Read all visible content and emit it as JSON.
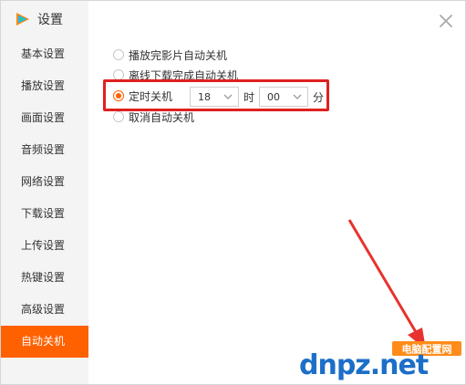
{
  "window": {
    "title": "设置"
  },
  "sidebar": {
    "items": [
      {
        "label": "基本设置"
      },
      {
        "label": "播放设置"
      },
      {
        "label": "画面设置"
      },
      {
        "label": "音频设置"
      },
      {
        "label": "网络设置"
      },
      {
        "label": "下载设置"
      },
      {
        "label": "上传设置"
      },
      {
        "label": "热键设置"
      },
      {
        "label": "高级设置"
      },
      {
        "label": "自动关机",
        "active": true
      }
    ]
  },
  "options": {
    "after_playback": "播放完影片自动关机",
    "after_download": "离线下载完成自动关机",
    "timed": "定时关机",
    "cancel": "取消自动关机",
    "selected": "timed"
  },
  "timer": {
    "hour_value": "18",
    "hour_unit": "时",
    "minute_value": "00",
    "minute_unit": "分"
  },
  "watermark": {
    "logo_text": "dnpz.net",
    "badge_text": "电脑配置网"
  },
  "colors": {
    "accent": "#ff6000",
    "annotation_red": "#e02020",
    "sidebar_bg": "#f4f4f4",
    "watermark_blue": "#1b6fc8"
  }
}
